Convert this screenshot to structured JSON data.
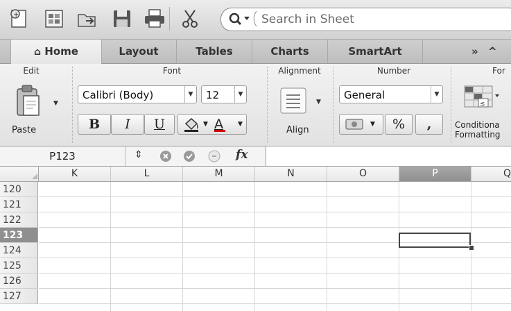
{
  "toolbar": {
    "icons": [
      "new-document-icon",
      "gallery-icon",
      "open-icon",
      "save-icon",
      "print-icon",
      "cut-icon"
    ],
    "search": {
      "placeholder": "Search in Sheet"
    }
  },
  "tabs": [
    {
      "label": "Home",
      "active": true
    },
    {
      "label": "Layout"
    },
    {
      "label": "Tables"
    },
    {
      "label": "Charts"
    },
    {
      "label": "SmartArt"
    }
  ],
  "tab_controls": {
    "overflow": "»",
    "collapse": "^"
  },
  "ribbon": {
    "edit": {
      "title": "Edit",
      "paste_label": "Paste"
    },
    "font": {
      "title": "Font",
      "family": "Calibri (Body)",
      "size": "12",
      "bold": "B",
      "italic": "I",
      "underline": "U",
      "font_color_letter": "A"
    },
    "alignment": {
      "title": "Alignment",
      "align_label": "Align"
    },
    "number": {
      "title": "Number",
      "format": "General",
      "percent": "%",
      "comma": ","
    },
    "format": {
      "title": "For",
      "conditional_line1": "Conditiona",
      "conditional_line2": "Formatting"
    }
  },
  "formula_bar": {
    "name_box": "P123",
    "stepper": "⇕",
    "fx": "fx",
    "value": ""
  },
  "columns": [
    {
      "label": "K"
    },
    {
      "label": "L"
    },
    {
      "label": "M"
    },
    {
      "label": "N"
    },
    {
      "label": "O"
    },
    {
      "label": "P",
      "selected": true
    },
    {
      "label": "Q"
    }
  ],
  "rows": [
    {
      "label": "120"
    },
    {
      "label": "121"
    },
    {
      "label": "122"
    },
    {
      "label": "123",
      "selected": true
    },
    {
      "label": "124"
    },
    {
      "label": "125"
    },
    {
      "label": "126"
    },
    {
      "label": "127"
    }
  ],
  "colors": {
    "selected_header": "#8f8f8f",
    "font_color_bar": "#d00000"
  }
}
